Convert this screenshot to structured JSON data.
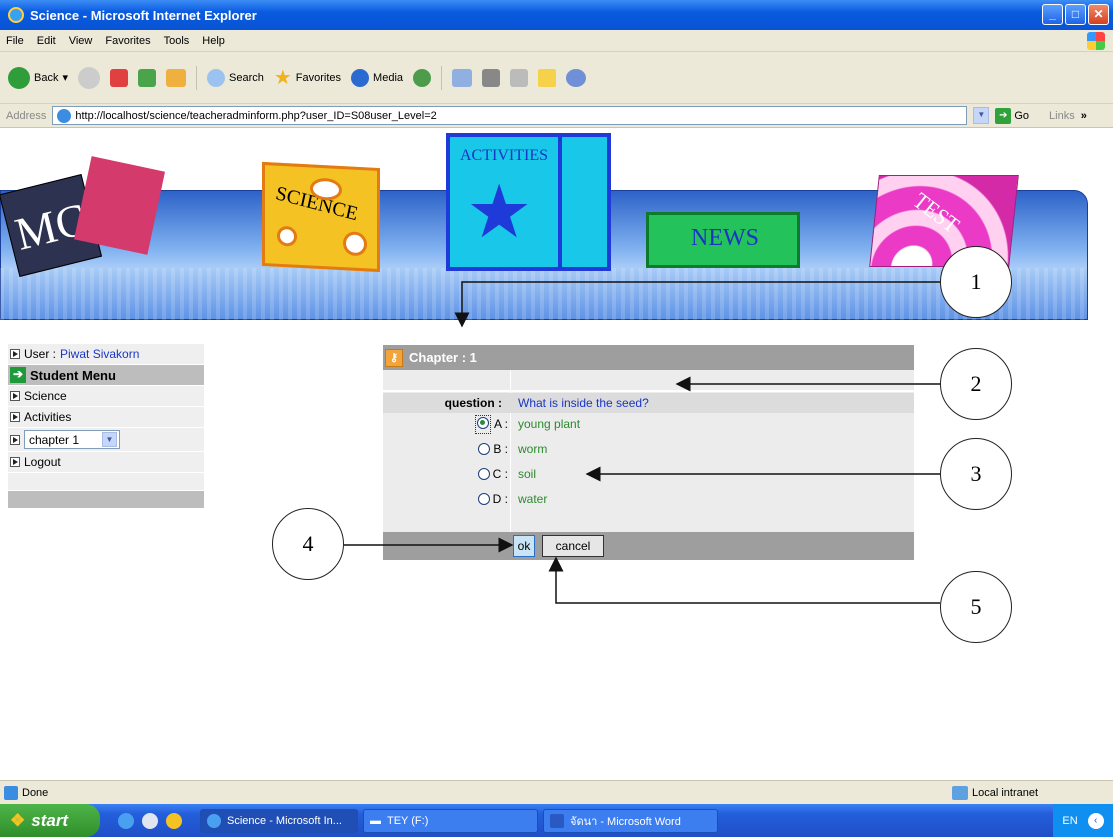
{
  "window": {
    "title": "Science - Microsoft Internet Explorer"
  },
  "menu": [
    "File",
    "Edit",
    "View",
    "Favorites",
    "Tools",
    "Help"
  ],
  "toolbar": {
    "back": "Back",
    "search": "Search",
    "favorites": "Favorites",
    "media": "Media"
  },
  "address": {
    "label": "Address",
    "url": "http://localhost/science/teacheradminform.php?user_ID=S08user_Level=2",
    "go": "Go",
    "links": "Links"
  },
  "banner": {
    "logo": "MC",
    "nav": [
      "SCIENCE",
      "ACTIVITIES",
      "NEWS",
      "TEST"
    ]
  },
  "sidebar": {
    "user_label": "User :",
    "user_name": "Piwat Sivakorn",
    "menu_title": "Student Menu",
    "items": [
      "Science",
      "Activities"
    ],
    "chapter_select": "chapter 1",
    "logout": "Logout"
  },
  "quiz": {
    "chapter": "Chapter : 1",
    "question_label": "question :",
    "question": "What is inside the seed?",
    "options": [
      {
        "letter": "A :",
        "text": "young plant",
        "selected": true
      },
      {
        "letter": "B :",
        "text": "worm",
        "selected": false
      },
      {
        "letter": "C :",
        "text": "soil",
        "selected": false
      },
      {
        "letter": "D :",
        "text": "water",
        "selected": false
      }
    ],
    "ok": "ok",
    "cancel": "cancel"
  },
  "callouts": [
    "1",
    "2",
    "3",
    "4",
    "5"
  ],
  "status": {
    "text": "Done",
    "zone": "Local intranet"
  },
  "taskbar": {
    "start": "start",
    "tasks": [
      "Science - Microsoft In...",
      "TEY (F:)",
      "จัดนา - Microsoft Word"
    ],
    "lang": "EN"
  }
}
